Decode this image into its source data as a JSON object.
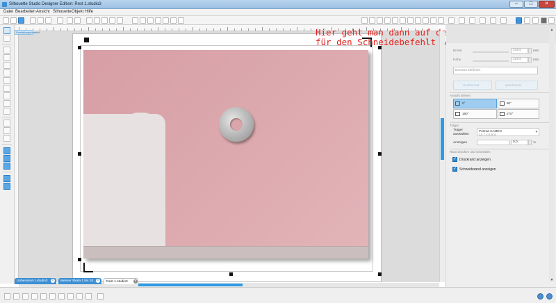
{
  "window": {
    "title": "Silhouette Studio Designer Edition: Rest 1.studio3"
  },
  "menu": [
    "Datei",
    "Bearbeiten",
    "Ansicht",
    "Silhouette",
    "Objekt",
    "Hilfe"
  ],
  "canvas": {
    "mode_label": "Gestaltungsbereich",
    "annotation": "Hier geht man dann auf den Letzten Buten ^\nfür den Schneidebefehlt A"
  },
  "panel": {
    "width_label": "Breite",
    "width_value": "238,0",
    "width_unit": "mm",
    "height_label": "Höhe",
    "height_value": "228,0",
    "height_unit": "mm",
    "custom_size": "Benutzerdefiniert",
    "portrait_label": "Hochformat",
    "landscape_label": "Querformat",
    "view_rotate_heading": "Ansicht drehen",
    "rot_0": "0°",
    "rot_90": "90°",
    "rot_180": "180°",
    "rot_270": "270°",
    "carrier_heading": "Träger",
    "carrier_select_label": "Träger auswählen",
    "carrier_value": "Portrait CAMEO",
    "carrier_sub": "12,7 x 8,5 in",
    "show_label": "Anzeigen",
    "show_value": "0,0",
    "show_unit": "%",
    "print_cut_heading": "Rand drucken und schneiden",
    "print_border": "Druckrand anzeigen",
    "cut_border": "Schneiderand anzeigen"
  },
  "tabs": [
    {
      "label": "Unbenannt-1.studio3",
      "active": false
    },
    {
      "label": "Messer Skala 1 bis 10...",
      "active": false
    },
    {
      "label": "Rest 1.studio3",
      "active": true
    }
  ],
  "colors": {
    "accent": "#2e9be3",
    "annotation": "#e0201c",
    "photo_pink": "#dba8ad"
  }
}
